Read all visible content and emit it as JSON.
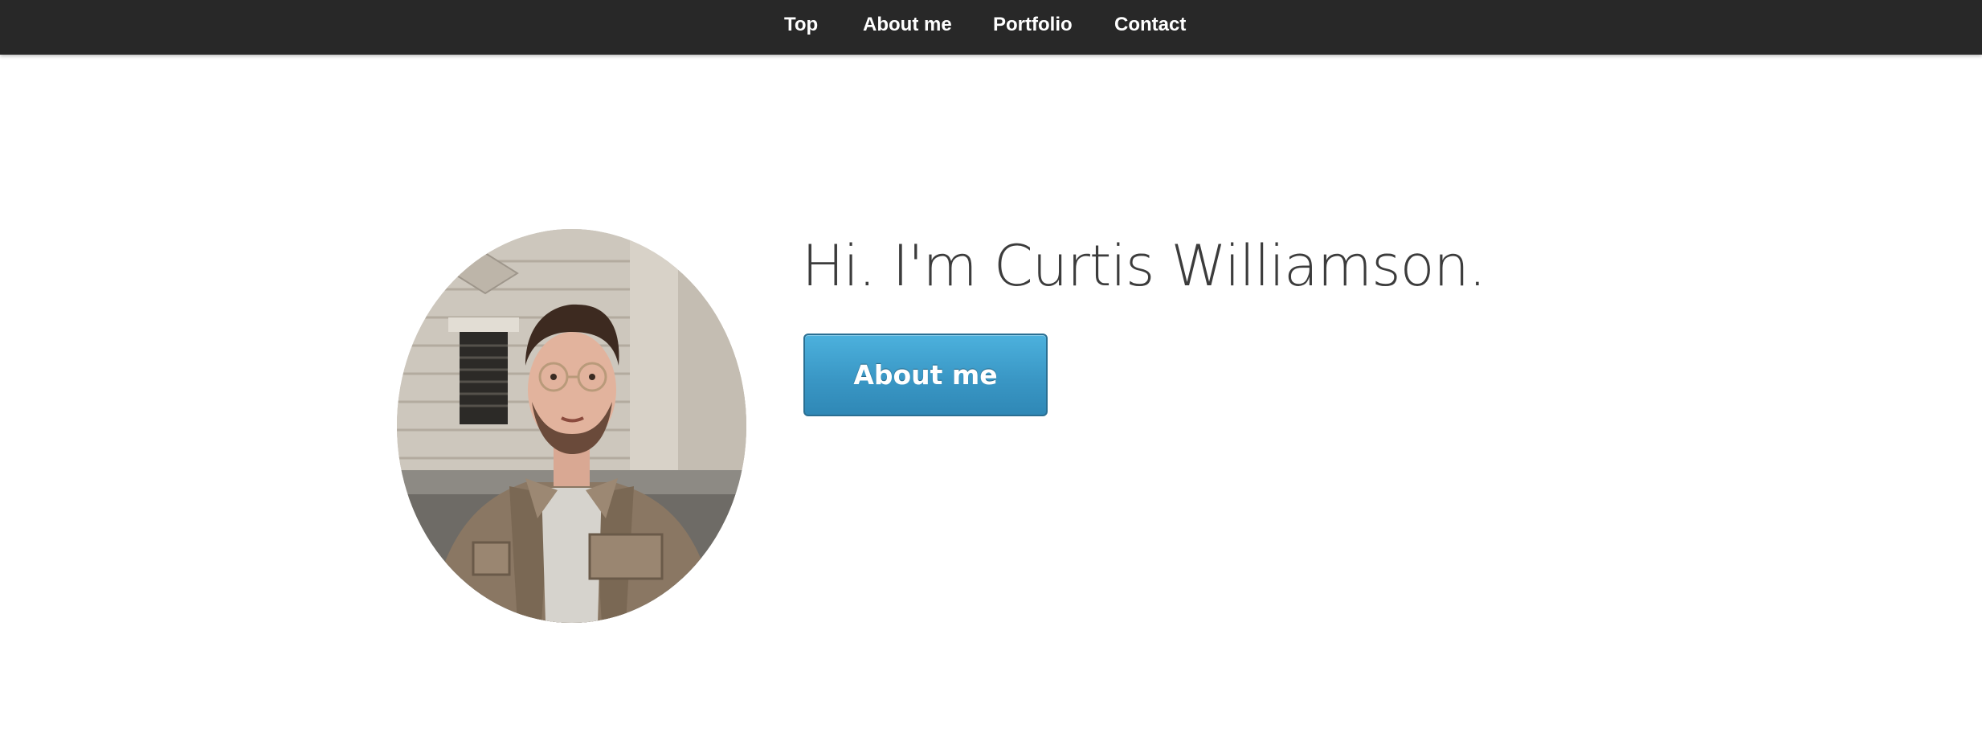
{
  "nav": {
    "items": [
      {
        "label": "Top"
      },
      {
        "label": "About me"
      },
      {
        "label": "Portfolio"
      },
      {
        "label": "Contact"
      }
    ]
  },
  "hero": {
    "title": "Hi. I'm Curtis Williamson.",
    "button_label": "About me",
    "portrait_icon": "portrait-photo"
  },
  "colors": {
    "nav_background": "#282828",
    "nav_text": "#ffffff",
    "title_text": "#3c3c3c",
    "button_blue": "#3a9fd0",
    "page_background": "#ffffff"
  }
}
